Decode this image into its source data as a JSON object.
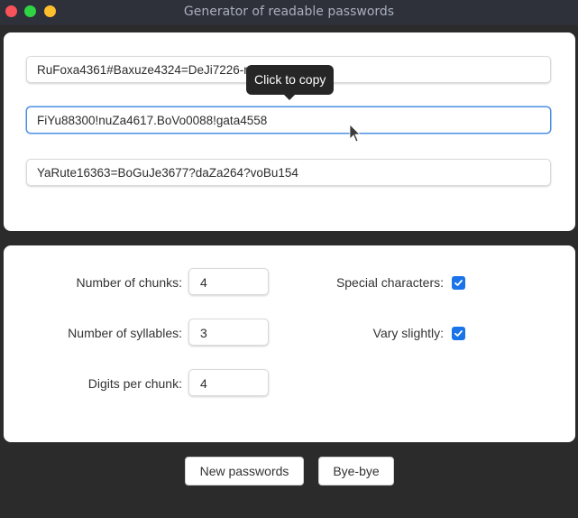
{
  "window": {
    "title": "Generator of readable passwords"
  },
  "passwords": [
    {
      "value": "RuFoxa4361#Baxuze4324=DeJi7226-re74446",
      "focused": false
    },
    {
      "value": "FiYu88300!nuZa4617.BoVo0088!gata4558",
      "focused": true
    },
    {
      "value": "YaRute16363=BoGuJe3677?daZa264?voBu154",
      "focused": false
    }
  ],
  "tooltip": {
    "text": "Click to copy"
  },
  "settings": {
    "chunks": {
      "label": "Number of chunks",
      "value": "4"
    },
    "syllables": {
      "label": "Number of syllables",
      "value": "3"
    },
    "digits": {
      "label": "Digits per chunk",
      "value": "4"
    },
    "special_characters": {
      "label": "Special characters",
      "checked": true
    },
    "vary_slightly": {
      "label": "Vary slightly",
      "checked": true
    },
    "label_separator": ":"
  },
  "buttons": {
    "new_passwords": "New passwords",
    "bye_bye": "Bye-bye"
  },
  "colors": {
    "accent": "#1a73e8",
    "focus_border": "#4a90e2",
    "titlebar": "#2e313a",
    "background": "#2b2b2b"
  }
}
